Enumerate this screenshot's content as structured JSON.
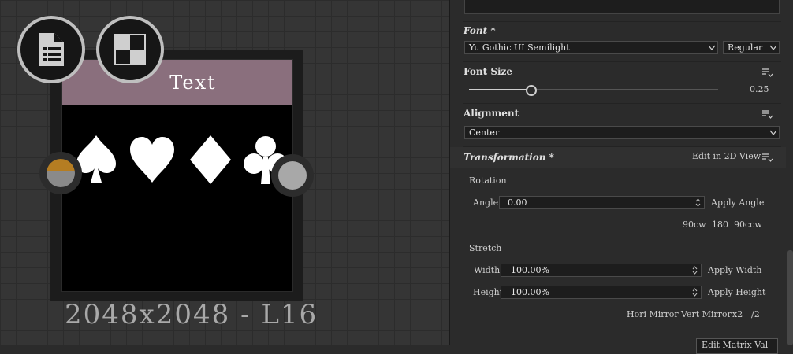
{
  "graph": {
    "node": {
      "header_text": "Text",
      "caption": "2048x2048 - L16",
      "header_color": "#8a6f7d"
    },
    "icons": {
      "left_button": "document-list-icon",
      "right_button": "checker-pattern-icon",
      "suits": [
        "spade-icon",
        "heart-icon",
        "diamond-icon",
        "club-icon"
      ]
    }
  },
  "panel": {
    "font": {
      "title": "Font *",
      "family_value": "Yu Gothic UI Semilight",
      "style_value": "Regular"
    },
    "font_size": {
      "title": "Font Size",
      "value": "0.25",
      "slider_fraction": 0.25
    },
    "alignment": {
      "title": "Alignment",
      "value": "Center"
    },
    "transformation": {
      "title": "Transformation *",
      "edit_link": "Edit in 2D View",
      "rotation": {
        "label": "Rotation",
        "angle_label": "Angle",
        "angle_value": "0.00",
        "apply": "Apply Angle",
        "presets": [
          "90cw",
          "180",
          "90ccw"
        ]
      },
      "stretch": {
        "label": "Stretch",
        "width_label": "Width",
        "width_value": "100.00%",
        "apply_width": "Apply Width",
        "height_label": "Height",
        "height_value": "100.00%",
        "apply_height": "Apply Height",
        "actions": [
          "Hori Mirror",
          "Vert Mirror",
          "x2",
          "/2"
        ]
      },
      "bottom_button": "Edit Matrix Val"
    }
  }
}
